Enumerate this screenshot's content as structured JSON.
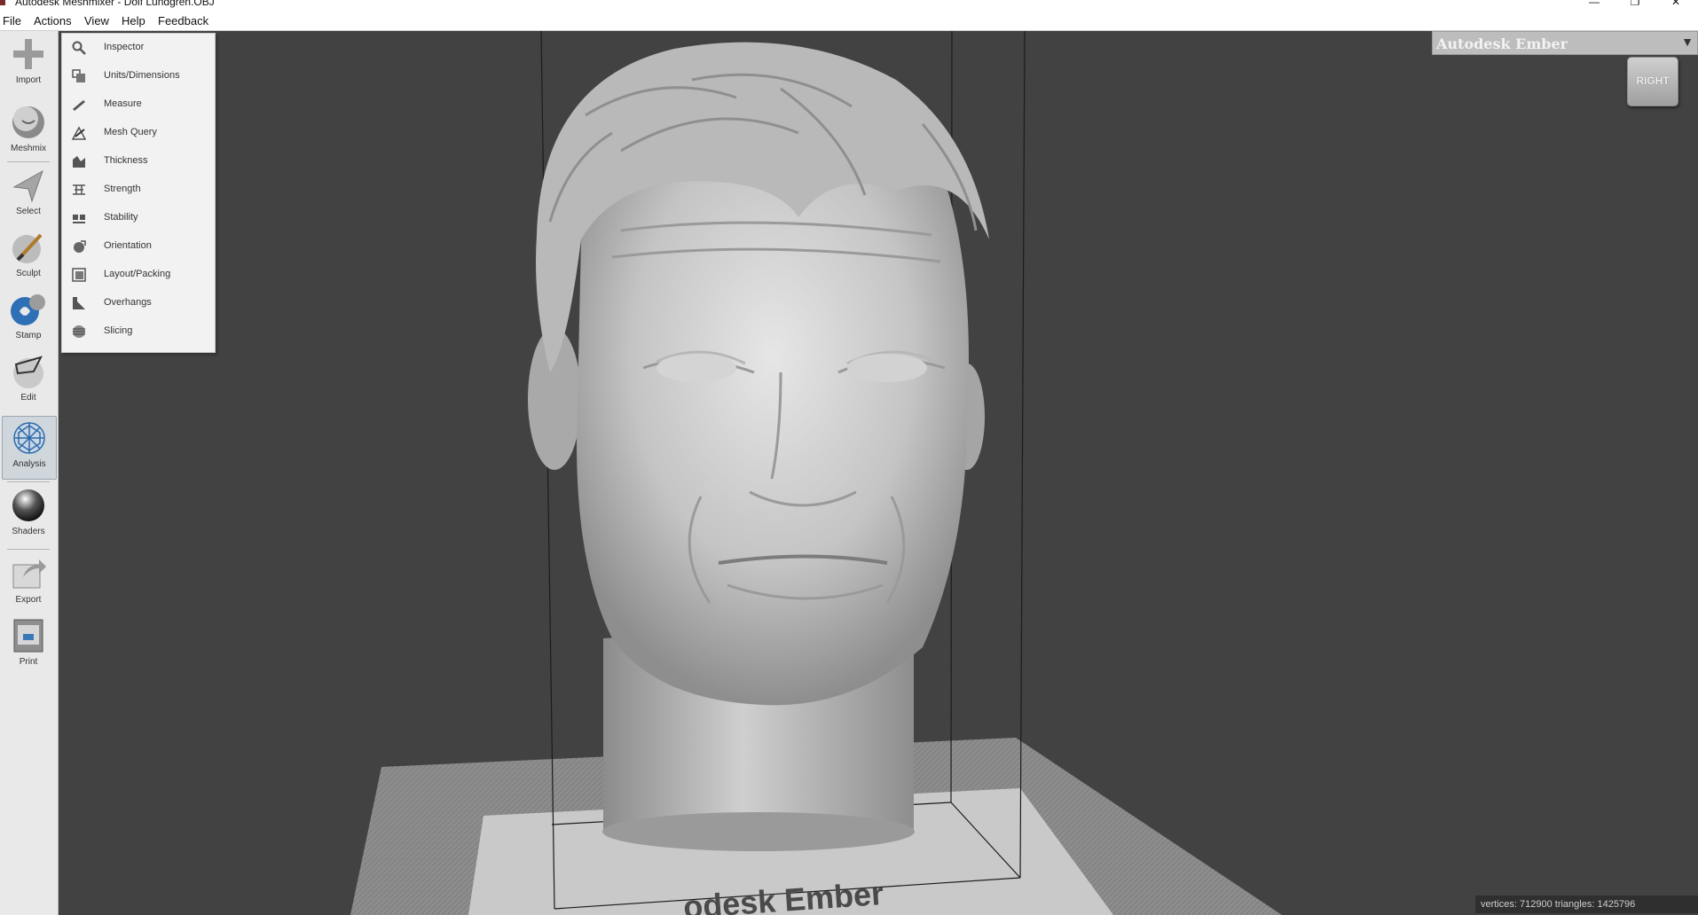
{
  "window": {
    "title": "Autodesk Meshmixer - Dolf Lundgren.OBJ",
    "minimize_glyph": "—",
    "restore_glyph": "❐",
    "close_glyph": "✕"
  },
  "menubar": {
    "items": [
      "File",
      "Actions",
      "View",
      "Help",
      "Feedback"
    ]
  },
  "toolbar": {
    "items": [
      {
        "label": "Import",
        "icon": "plus-icon"
      },
      {
        "label": "Meshmix",
        "icon": "meshmix-bust-icon"
      },
      {
        "label": "Select",
        "icon": "arrow-pointer-icon"
      },
      {
        "label": "Sculpt",
        "icon": "sculpt-brush-icon"
      },
      {
        "label": "Stamp",
        "icon": "stamp-icon"
      },
      {
        "label": "Edit",
        "icon": "edit-sphere-icon"
      },
      {
        "label": "Analysis",
        "icon": "analysis-mesh-icon"
      },
      {
        "label": "Shaders",
        "icon": "shader-sphere-icon"
      },
      {
        "label": "Export",
        "icon": "export-icon"
      },
      {
        "label": "Print",
        "icon": "printer-icon"
      }
    ],
    "active": "Analysis"
  },
  "analysis_menu": {
    "items": [
      {
        "label": "Inspector",
        "icon": "magnifier-icon"
      },
      {
        "label": "Units/Dimensions",
        "icon": "units-box-icon"
      },
      {
        "label": "Measure",
        "icon": "ruler-icon"
      },
      {
        "label": "Mesh Query",
        "icon": "mesh-query-icon"
      },
      {
        "label": "Thickness",
        "icon": "thickness-icon"
      },
      {
        "label": "Strength",
        "icon": "strength-icon"
      },
      {
        "label": "Stability",
        "icon": "stability-icon"
      },
      {
        "label": "Orientation",
        "icon": "orientation-icon"
      },
      {
        "label": "Layout/Packing",
        "icon": "layout-packing-icon"
      },
      {
        "label": "Overhangs",
        "icon": "overhangs-icon"
      },
      {
        "label": "Slicing",
        "icon": "slicing-icon"
      }
    ]
  },
  "printer": {
    "selected": "Autodesk Ember",
    "bed_label": "odesk Ember"
  },
  "view_cube": {
    "face": "RIGHT"
  },
  "stats": {
    "text": "vertices: 712900 triangles: 1425796"
  },
  "colors": {
    "background": "#424242",
    "toolbar": "#e9e9e9",
    "menu": "#f2f2f2",
    "active_tool": "#cfd6dc",
    "printer_bar": "#bdbdbd"
  }
}
